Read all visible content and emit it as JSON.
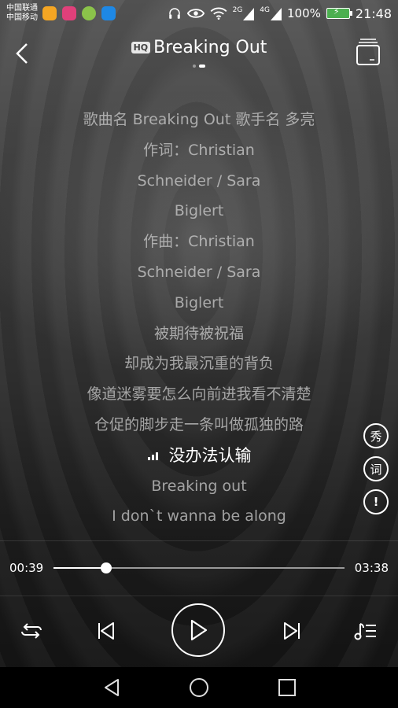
{
  "status_bar": {
    "carrier1": "中国联通",
    "carrier2": "中国移动",
    "battery_percent": "100%",
    "time": "21:48",
    "signal1": "2G",
    "signal2": "4G"
  },
  "header": {
    "hq_badge": "HQ",
    "title": "Breaking Out",
    "page_count": 2,
    "active_page": 2
  },
  "lyrics": [
    "歌曲名 Breaking Out 歌手名 多亮",
    "作词：Christian",
    "Schneider / Sara",
    "Biglert",
    "作曲：Christian",
    "Schneider / Sara",
    "Biglert",
    "被期待被祝福",
    "却成为我最沉重的背负",
    "像道迷雾要怎么向前进我看不清楚",
    "仓促的脚步走一条叫做孤独的路",
    "没办法认输",
    "Breaking out",
    "I don`t wanna be along"
  ],
  "current_lyric_index": 11,
  "side_buttons": {
    "show_label": "秀",
    "lyric_label": "词",
    "report_label": "!"
  },
  "progress": {
    "current_time": "00:39",
    "duration": "03:38",
    "fraction": 0.18
  },
  "controls": {
    "repeat_icon": "repeat-icon",
    "prev_icon": "skip-previous-icon",
    "play_icon": "play-icon",
    "next_icon": "skip-next-icon",
    "playlist_icon": "playlist-icon"
  }
}
